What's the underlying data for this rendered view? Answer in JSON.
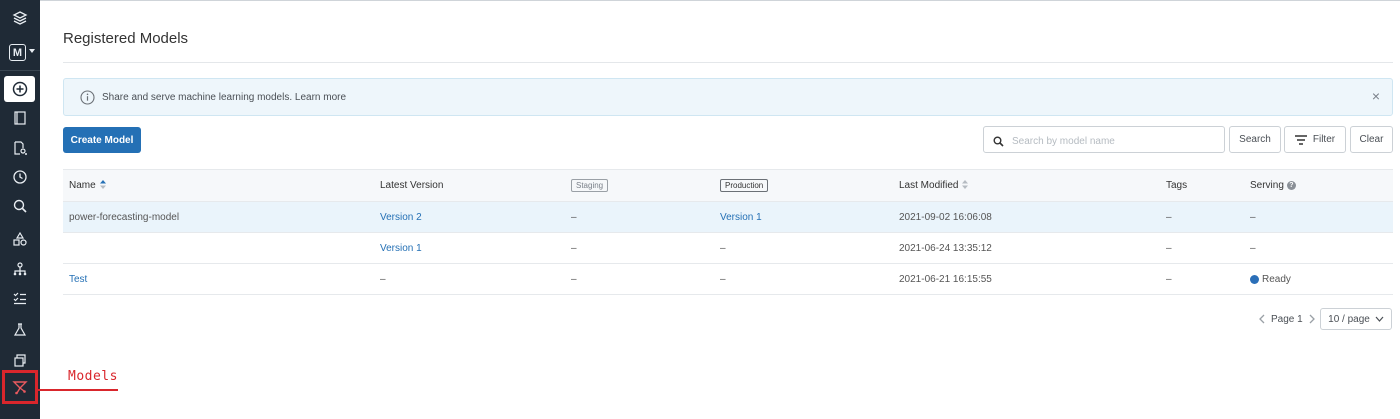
{
  "sidebar": {
    "workspace_initial": "M",
    "items": [
      {
        "name": "Create",
        "icon": "plus-circle-icon"
      },
      {
        "name": "Workspace",
        "icon": "notebook-icon"
      },
      {
        "name": "Repos",
        "icon": "repos-icon"
      },
      {
        "name": "Recents",
        "icon": "clock-icon"
      },
      {
        "name": "Search",
        "icon": "search-icon"
      },
      {
        "name": "Data",
        "icon": "data-icon"
      },
      {
        "name": "Clusters",
        "icon": "cluster-icon"
      },
      {
        "name": "Jobs",
        "icon": "jobs-icon"
      },
      {
        "name": "Experiments",
        "icon": "flask-icon"
      },
      {
        "name": "Feature Store",
        "icon": "stack-icon"
      },
      {
        "name": "Models",
        "icon": "models-icon"
      }
    ]
  },
  "callout": {
    "label": "Models",
    "color": "#d9262c"
  },
  "page": {
    "title": "Registered Models"
  },
  "banner": {
    "text": "Share and serve machine learning models. Learn more",
    "close": "×"
  },
  "toolbar": {
    "create_label": "Create Model",
    "search_placeholder": "Search by model name",
    "search_label": "Search",
    "filter_label": "Filter",
    "clear_label": "Clear"
  },
  "table": {
    "headers": {
      "name": "Name",
      "latest": "Latest Version",
      "staging": "Staging",
      "production": "Production",
      "modified": "Last Modified",
      "tags": "Tags",
      "serving": "Serving"
    },
    "rows": [
      {
        "name": "power-forecasting-model",
        "latest": "Version 2",
        "staging": "–",
        "production": "Version 1",
        "modified": "2021-09-02 16:06:08",
        "tags": "–",
        "serving": "–"
      },
      {
        "name": "",
        "latest": "Version 1",
        "staging": "–",
        "production": "–",
        "modified": "2021-06-24 13:35:12",
        "tags": "–",
        "serving": "–"
      },
      {
        "name": "Test",
        "latest": "–",
        "staging": "–",
        "production": "–",
        "modified": "2021-06-21 16:15:55",
        "tags": "–",
        "serving": "Ready"
      }
    ]
  },
  "pagination": {
    "page_label": "Page 1",
    "page_size": "10 / page"
  },
  "colors": {
    "primary": "#2470b5",
    "sidebar": "#1f2a36",
    "banner_bg": "#eef6fb",
    "highlight_row": "#eaf4fb"
  }
}
